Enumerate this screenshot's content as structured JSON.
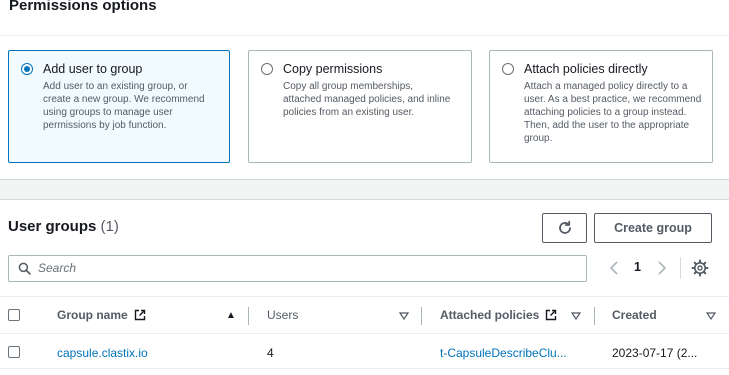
{
  "permissions": {
    "title": "Permissions options",
    "options": [
      {
        "title": "Add user to group",
        "description": "Add user to an existing group, or create a new group. We recommend using groups to manage user permissions by job function.",
        "selected": true
      },
      {
        "title": "Copy permissions",
        "description": "Copy all group memberships, attached managed policies, and inline policies from an existing user.",
        "selected": false
      },
      {
        "title": "Attach policies directly",
        "description": "Attach a managed policy directly to a user. As a best practice, we recommend attaching policies to a group instead. Then, add the user to the appropriate group.",
        "selected": false
      }
    ]
  },
  "groups": {
    "title": "User groups",
    "count": "(1)",
    "create_label": "Create group",
    "search_placeholder": "Search",
    "page": "1",
    "columns": {
      "name": "Group name",
      "users": "Users",
      "policies": "Attached policies",
      "created": "Created"
    },
    "rows": [
      {
        "name": "capsule.clastix.io",
        "users": "4",
        "policies": "t-CapsuleDescribeClu...",
        "created": "2023-07-17 (2..."
      }
    ]
  },
  "colors": {
    "accent": "#0073bb",
    "selected_bg": "#f1faff",
    "border": "#aab7b8",
    "text": "#16191f",
    "muted": "#545b64"
  },
  "icons": [
    "refresh-icon",
    "search-icon",
    "chevron-left-icon",
    "chevron-right-icon",
    "gear-icon",
    "external-link-icon",
    "sort-up-icon",
    "sort-down-icon"
  ]
}
